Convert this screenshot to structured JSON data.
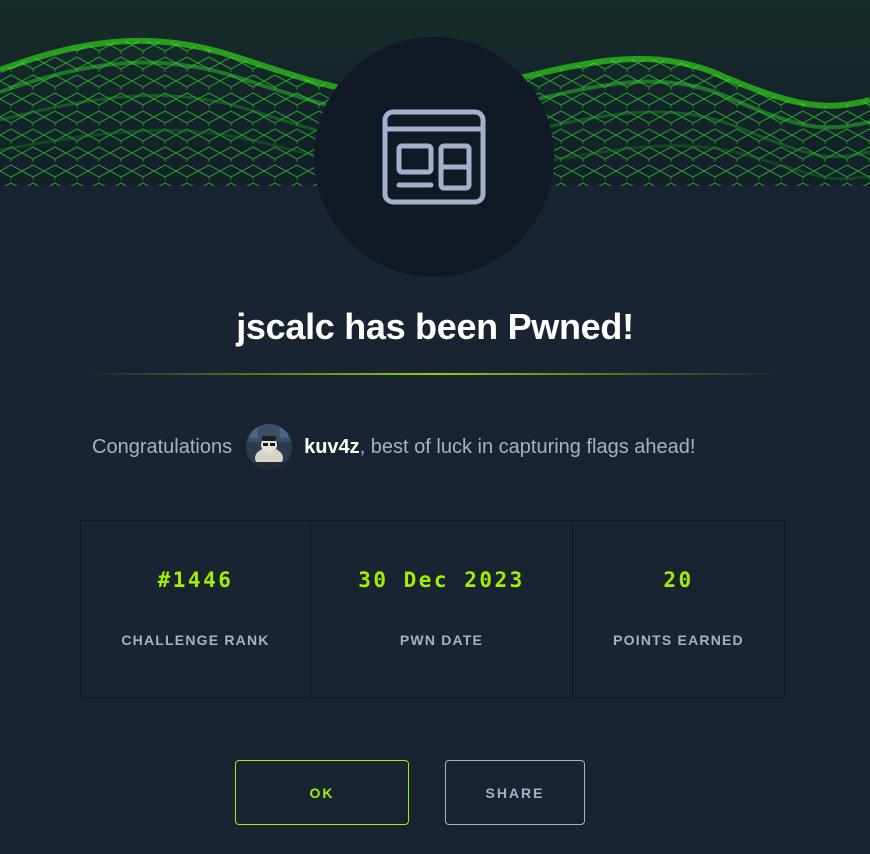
{
  "dialog": {
    "title": "jscalc has been Pwned!",
    "header_icon": "browser-window-icon"
  },
  "congrats": {
    "prefix": "Congratulations",
    "username": "kuv4z",
    "suffix": ", best of luck in capturing flags ahead!"
  },
  "stats": [
    {
      "value": "#1446",
      "label": "CHALLENGE RANK"
    },
    {
      "value": "30 Dec 2023",
      "label": "PWN DATE"
    },
    {
      "value": "20",
      "label": "POINTS EARNED"
    }
  ],
  "buttons": {
    "ok_label": "OK",
    "share_label": "SHARE"
  },
  "colors": {
    "accent": "#9fef00",
    "background": "#1a2332",
    "muted_text": "#a4b1cd"
  }
}
